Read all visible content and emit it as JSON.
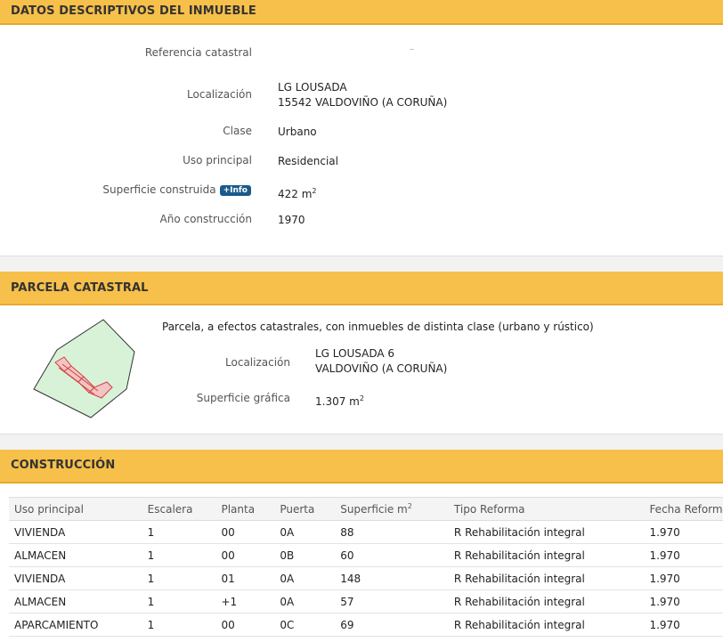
{
  "descriptivos": {
    "header": "DATOS DESCRIPTIVOS DEL INMUEBLE",
    "fields": [
      {
        "label": "Referencia catastral",
        "value": "–"
      },
      {
        "label": "Localización",
        "value_line1": "LG LOUSADA",
        "value_line2": "15542 VALDOVIÑO (A CORUÑA)"
      },
      {
        "label": "Clase",
        "value": "Urbano"
      },
      {
        "label": "Uso principal",
        "value": "Residencial"
      },
      {
        "label": "Superficie construida",
        "info_badge": "+Info",
        "value": "422 m",
        "unit_sup": "2"
      },
      {
        "label": "Año construcción",
        "value": "1970"
      }
    ]
  },
  "parcela": {
    "header": "PARCELA CATASTRAL",
    "note": "Parcela, a efectos catastrales, con inmuebles de distinta clase (urbano y rústico)",
    "localizacion_label": "Localización",
    "localizacion_line1": "LG LOUSADA 6",
    "localizacion_line2": "VALDOVIÑO (A CORUÑA)",
    "superficie_label": "Superficie gráfica",
    "superficie_value": "1.307 m",
    "superficie_sup": "2",
    "colors": {
      "parcel_fill": "#d8f2d8",
      "building_fill": "#f4c4c4",
      "building_stroke": "#d04040"
    }
  },
  "construccion": {
    "header": "CONSTRUCCIÓN",
    "columns": [
      "Uso principal",
      "Escalera",
      "Planta",
      "Puerta",
      "Superficie m",
      "Tipo Reforma",
      "Fecha Reforma"
    ],
    "superficie_sup": "2",
    "rows": [
      [
        "VIVIENDA",
        "1",
        "00",
        "0A",
        "88",
        "R Rehabilitación integral",
        "1.970"
      ],
      [
        "ALMACEN",
        "1",
        "00",
        "0B",
        "60",
        "R Rehabilitación integral",
        "1.970"
      ],
      [
        "VIVIENDA",
        "1",
        "01",
        "0A",
        "148",
        "R Rehabilitación integral",
        "1.970"
      ],
      [
        "ALMACEN",
        "1",
        "+1",
        "0A",
        "57",
        "R Rehabilitación integral",
        "1.970"
      ],
      [
        "APARCAMIENTO",
        "1",
        "00",
        "0C",
        "69",
        "R Rehabilitación integral",
        "1.970"
      ]
    ]
  }
}
